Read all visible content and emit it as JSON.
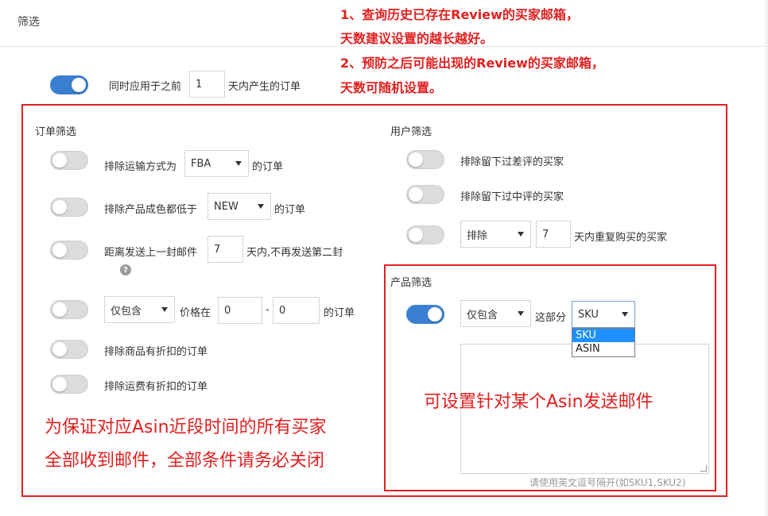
{
  "header": {
    "title": "筛选"
  },
  "annotations": {
    "top_line1": "1、查询历史已存在Review的买家邮箱，",
    "top_line2": "天数建议设置的越长越好。",
    "top_line3": "2、预防之后可能出现的Review的买家邮箱，",
    "top_line4": "天数可随机设置。",
    "asin_note": "可设置针对某个Asin发送邮件",
    "bottom_line1": "为保证对应Asin近段时间的所有买家",
    "bottom_line2": "全部收到邮件，全部条件请务必关闭",
    "color": "#e02020"
  },
  "global_rule": {
    "toggle_on": true,
    "prefix": "同时应用于之前",
    "days": "1",
    "suffix": "天内产生的订单"
  },
  "order_filter": {
    "title": "订单筛选",
    "ship_method": {
      "toggle_on": false,
      "prefix": "排除运输方式为",
      "value": "FBA",
      "suffix": "的订单"
    },
    "condition": {
      "toggle_on": false,
      "prefix": "排除产品成色都低于",
      "value": "NEW",
      "suffix": "的订单"
    },
    "last_mail": {
      "toggle_on": false,
      "prefix": "距离发送上一封邮件",
      "days": "7",
      "suffix": "天内,不再发送第二封",
      "help_icon": "question-circle-icon"
    },
    "price": {
      "toggle_on": false,
      "mode": "仅包含",
      "prefix": "价格在",
      "min": "0",
      "dash": "-",
      "max": "0",
      "suffix": "的订单"
    },
    "discount_item": {
      "toggle_on": false,
      "label": "排除商品有折扣的订单"
    },
    "discount_shipping": {
      "toggle_on": false,
      "label": "排除运费有折扣的订单"
    }
  },
  "user_filter": {
    "title": "用户筛选",
    "negative_review": {
      "toggle_on": false,
      "label": "排除留下过差评的买家"
    },
    "neutral_review": {
      "toggle_on": false,
      "label": "排除留下过中评的买家"
    },
    "repeat_buyer": {
      "toggle_on": false,
      "mode": "排除",
      "days": "7",
      "suffix": "天内重复购买的买家"
    }
  },
  "product_filter": {
    "title": "产品筛选",
    "toggle_on": true,
    "mode": "仅包含",
    "middle": "这部分",
    "field_value": "SKU",
    "field_options": [
      "SKU",
      "ASIN"
    ],
    "hint": "请使用英文逗号隔开(如SKU1,SKU2)"
  },
  "colors": {
    "accent": "#3b7fd0",
    "highlight": "#1e90ff",
    "frame": "#e02020"
  }
}
